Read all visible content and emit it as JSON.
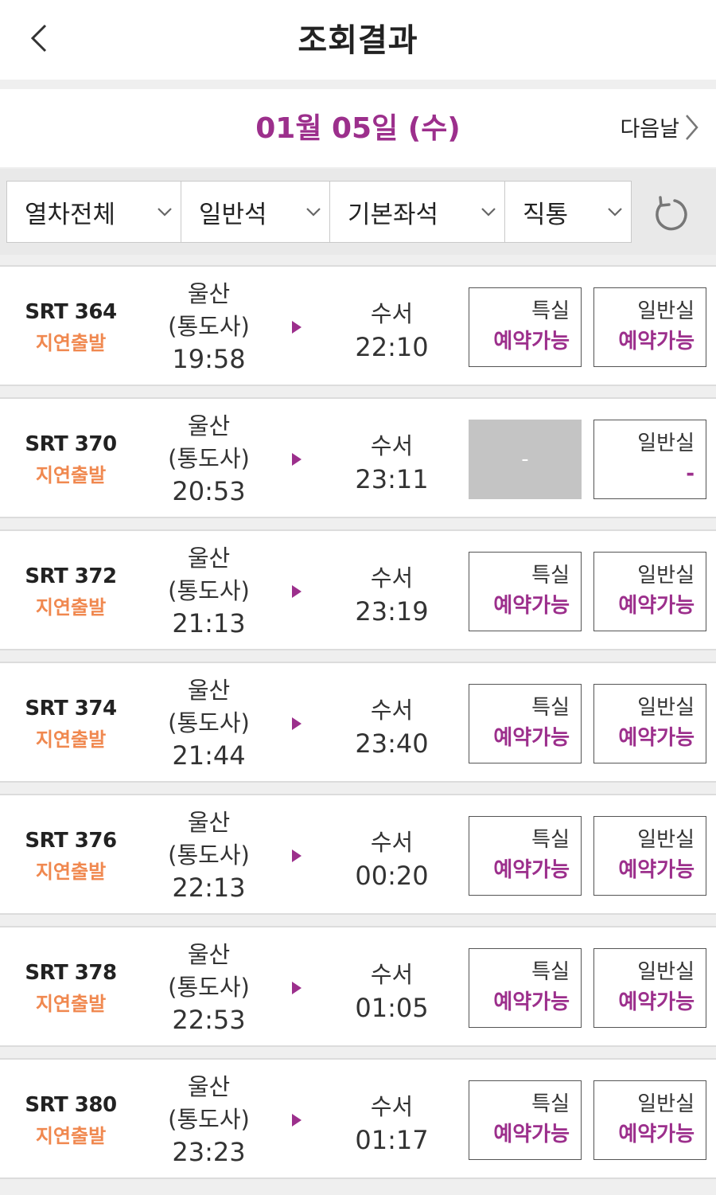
{
  "header": {
    "title": "조회결과"
  },
  "datebar": {
    "date": "01월 05일 (수)",
    "next_label": "다음날"
  },
  "filters": [
    {
      "label": "열차전체"
    },
    {
      "label": "일반석"
    },
    {
      "label": "기본좌석"
    },
    {
      "label": "직통"
    }
  ],
  "trains": [
    {
      "train_no": "SRT 364",
      "status": "지연출발",
      "dep_station": "울산",
      "dep_sub": "(통도사)",
      "dep_time": "19:58",
      "arr_station": "수서",
      "arr_time": "22:10",
      "special": {
        "class": "특실",
        "avail": "예약가능",
        "disabled": false
      },
      "general": {
        "class": "일반실",
        "avail": "예약가능",
        "disabled": false
      }
    },
    {
      "train_no": "SRT 370",
      "status": "지연출발",
      "dep_station": "울산",
      "dep_sub": "(통도사)",
      "dep_time": "20:53",
      "arr_station": "수서",
      "arr_time": "23:11",
      "special": {
        "class": "",
        "avail": "-",
        "disabled": true
      },
      "general": {
        "class": "일반실",
        "avail": "-",
        "disabled": false
      }
    },
    {
      "train_no": "SRT 372",
      "status": "지연출발",
      "dep_station": "울산",
      "dep_sub": "(통도사)",
      "dep_time": "21:13",
      "arr_station": "수서",
      "arr_time": "23:19",
      "special": {
        "class": "특실",
        "avail": "예약가능",
        "disabled": false
      },
      "general": {
        "class": "일반실",
        "avail": "예약가능",
        "disabled": false
      }
    },
    {
      "train_no": "SRT 374",
      "status": "지연출발",
      "dep_station": "울산",
      "dep_sub": "(통도사)",
      "dep_time": "21:44",
      "arr_station": "수서",
      "arr_time": "23:40",
      "special": {
        "class": "특실",
        "avail": "예약가능",
        "disabled": false
      },
      "general": {
        "class": "일반실",
        "avail": "예약가능",
        "disabled": false
      }
    },
    {
      "train_no": "SRT 376",
      "status": "지연출발",
      "dep_station": "울산",
      "dep_sub": "(통도사)",
      "dep_time": "22:13",
      "arr_station": "수서",
      "arr_time": "00:20",
      "special": {
        "class": "특실",
        "avail": "예약가능",
        "disabled": false
      },
      "general": {
        "class": "일반실",
        "avail": "예약가능",
        "disabled": false
      }
    },
    {
      "train_no": "SRT 378",
      "status": "지연출발",
      "dep_station": "울산",
      "dep_sub": "(통도사)",
      "dep_time": "22:53",
      "arr_station": "수서",
      "arr_time": "01:05",
      "special": {
        "class": "특실",
        "avail": "예약가능",
        "disabled": false
      },
      "general": {
        "class": "일반실",
        "avail": "예약가능",
        "disabled": false
      }
    },
    {
      "train_no": "SRT 380",
      "status": "지연출발",
      "dep_station": "울산",
      "dep_sub": "(통도사)",
      "dep_time": "23:23",
      "arr_station": "수서",
      "arr_time": "01:17",
      "special": {
        "class": "특실",
        "avail": "예약가능",
        "disabled": false
      },
      "general": {
        "class": "일반실",
        "avail": "예약가능",
        "disabled": false
      }
    }
  ],
  "colors": {
    "accent": "#9c2f8c",
    "status": "#f0884f",
    "disabled": "#c4c4c4"
  },
  "icons": {
    "back": "chevron-left-icon",
    "next": "chevron-right-icon",
    "dropdown": "chevron-down-icon",
    "refresh": "refresh-icon",
    "direction": "triangle-right-icon"
  }
}
